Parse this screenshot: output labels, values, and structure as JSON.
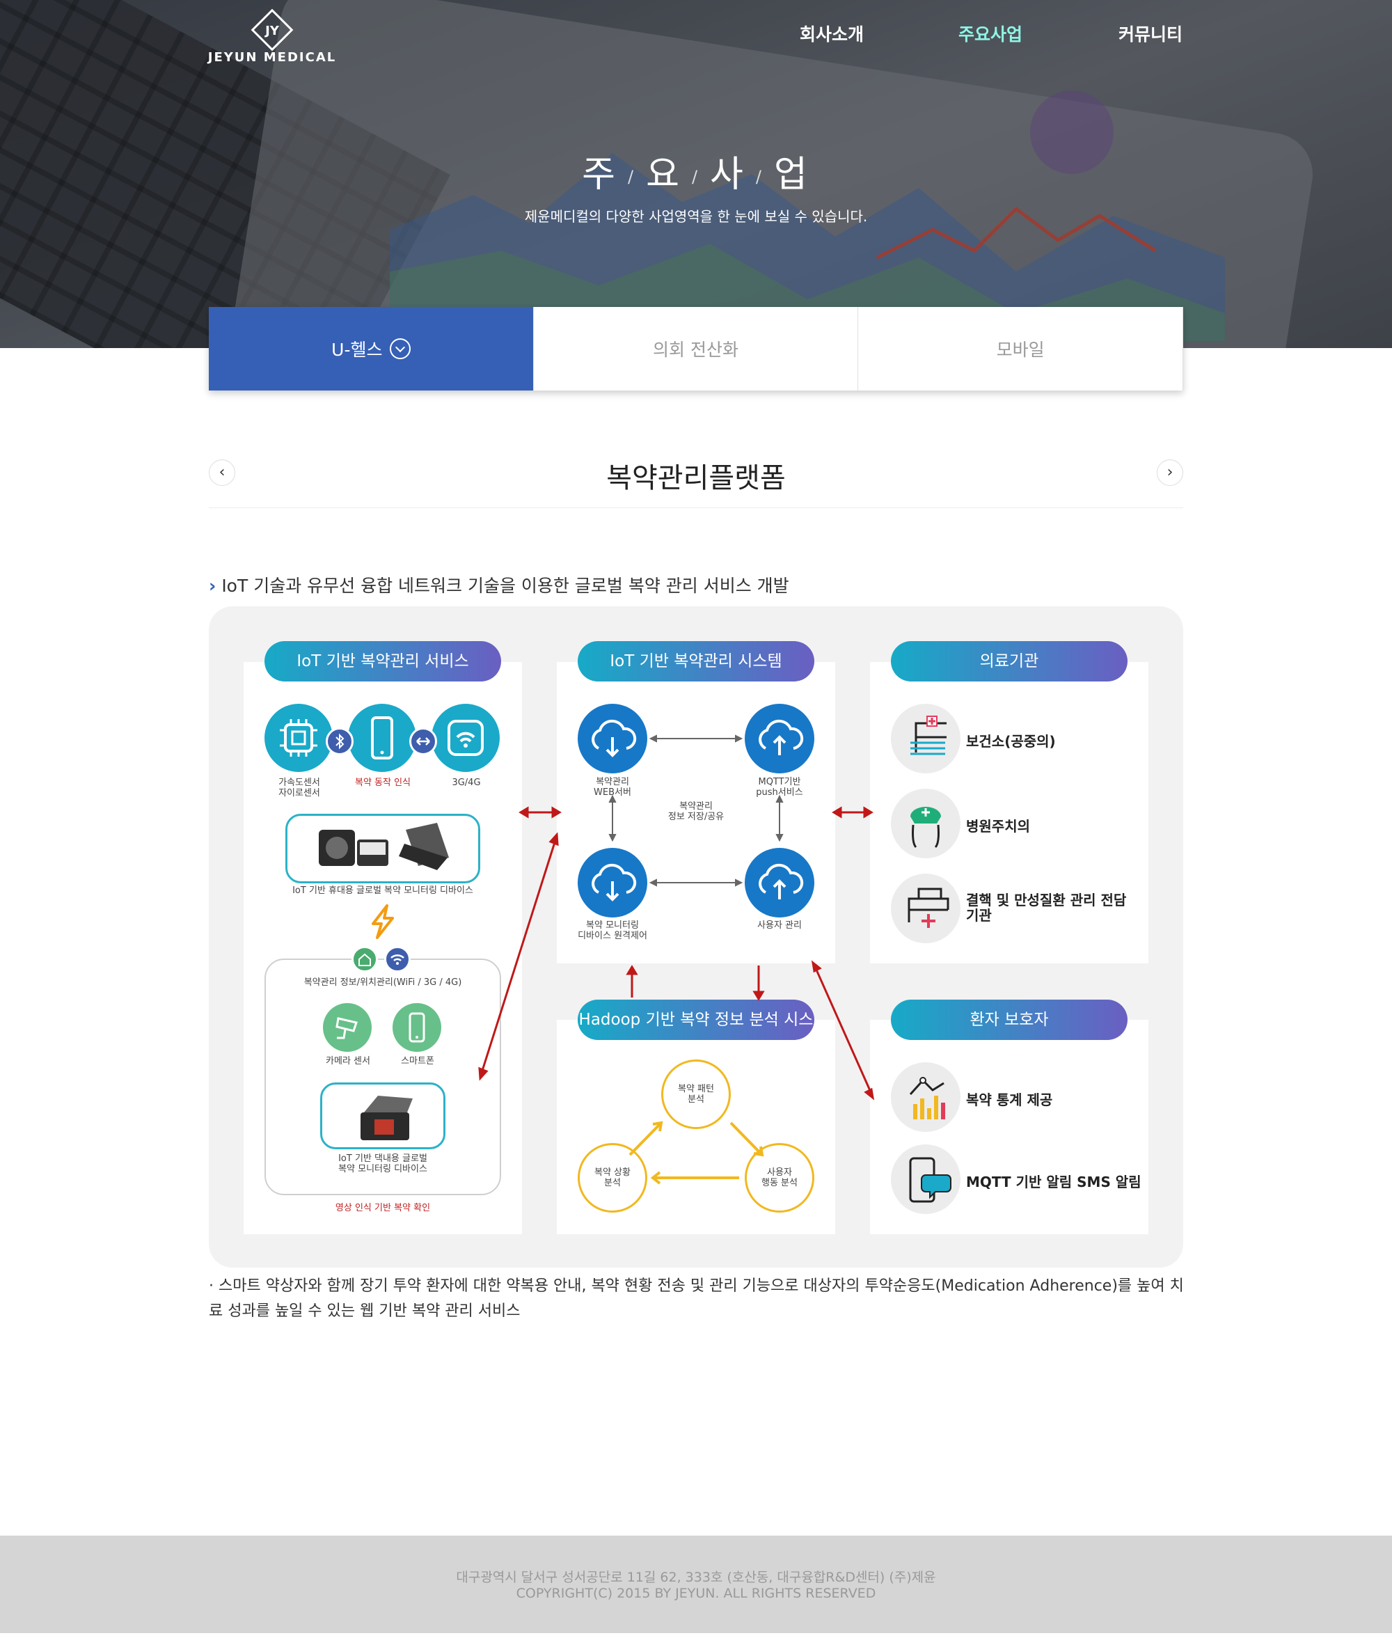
{
  "brand": {
    "name": "JEYUN MEDICAL",
    "mark": "JY"
  },
  "nav": {
    "items": [
      {
        "label": "회사소개"
      },
      {
        "label": "주요사업",
        "active": true
      },
      {
        "label": "커뮤니티"
      }
    ]
  },
  "hero": {
    "title_chars": [
      "주",
      "요",
      "사",
      "업"
    ],
    "subtitle": "제윤메디컬의 다양한 사업영역을 한 눈에 보실 수 있습니다."
  },
  "tabs": [
    {
      "label": "U-헬스",
      "active": true
    },
    {
      "label": "의회 전산화"
    },
    {
      "label": "모바일"
    }
  ],
  "section": {
    "title": "복약관리플랫폼",
    "prev": "‹",
    "next": "›"
  },
  "lead": {
    "icon": "›",
    "text": "IoT 기술과 유무선 융합 네트워크 기술을 이용한 글로벌 복약 관리 서비스 개발"
  },
  "diagram": {
    "col1": {
      "title": "IoT 기반 복약관리 서비스",
      "sensor1": "가속도센서\n자이로센서",
      "sensor2": "복약 동작 인식",
      "sensor3": "3G/4G",
      "portable": "IoT 기반 휴대용 글로벌 복약 모니터링 디바이스",
      "network": "복약관리 정보/위치관리(WiFi / 3G / 4G)",
      "camera": "카메라 센서",
      "phone": "스마트폰",
      "home": "IoT 기반 댁내용 글로벌\n복약 모니터링 디바이스",
      "vision": "영상 인식 기반 복약 확인"
    },
    "col2": {
      "title": "IoT 기반 복약관리 시스템",
      "web": "복약관리\nWEB서버",
      "push": "MQTT기반\npush서비스",
      "center": "복약관리\n정보 저장/공유",
      "remote": "복약 모니터링\n디바이스 원격제어",
      "users": "사용자 관리"
    },
    "col2b": {
      "title": "Hadoop 기반 복약 정보 분석 시스템",
      "pattern": "복약 패턴\n분석",
      "situation": "복약 상황\n분석",
      "behavior": "사용자\n행동 분석"
    },
    "col3": {
      "title": "의료기관",
      "items": [
        "보건소(공중의)",
        "병원주치의",
        "결핵 및 만성질환 관리 전담\n기관"
      ]
    },
    "col3b": {
      "title": "환자 보호자",
      "items": [
        "복약 통계 제공",
        "MQTT 기반 알림 SMS 알림"
      ]
    }
  },
  "description": "· 스마트 약상자와 함께 장기 투약 환자에 대한 약복용 안내, 복약 현황 전송 및 관리 기능으로 대상자의 투약순응도(Medication Adherence)를 높여 치료 성과를 높일 수 있는 웹 기반 복약 관리 서비스",
  "footer": {
    "address": "대구광역시 달서구 성서공단로 11길 62, 333호 (호산동, 대구융합R&D센터) (주)제윤",
    "copyright": "COPYRIGHT(C) 2015 BY JEYUN. ALL RIGHTS RESERVED"
  },
  "colors": {
    "accent": "#3660b6",
    "nav_active": "#8ef5e6",
    "teal": "#1aa9c9",
    "blue": "#1778c8",
    "red_arrow": "#c01818",
    "yellow": "#f1b81f"
  }
}
